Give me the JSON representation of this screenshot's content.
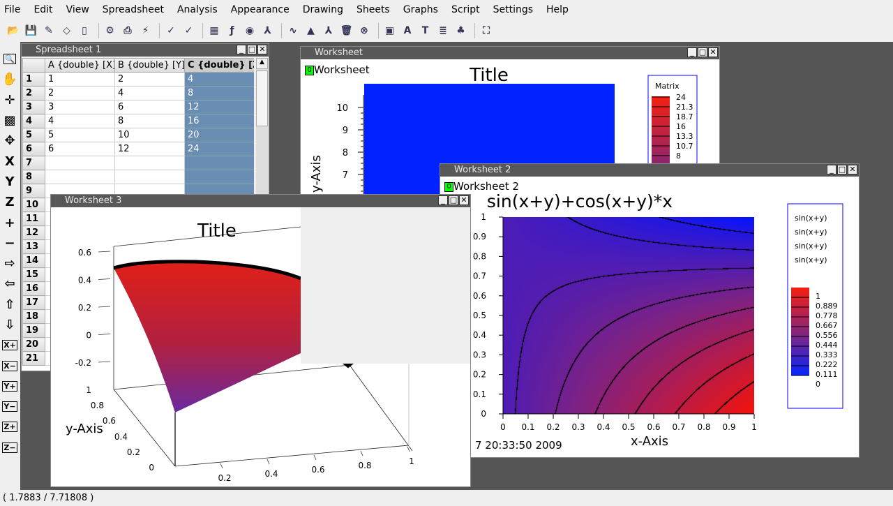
{
  "menu": [
    "File",
    "Edit",
    "View",
    "Spreadsheet",
    "Analysis",
    "Appearance",
    "Drawing",
    "Sheets",
    "Graphs",
    "Script",
    "Settings",
    "Help"
  ],
  "toolbar": [
    {
      "icon": "open-folder-icon",
      "glyph": "📂"
    },
    {
      "icon": "save-icon",
      "glyph": "💾"
    },
    {
      "icon": "edit-icon",
      "glyph": "✎"
    },
    {
      "icon": "eraser-icon",
      "glyph": "◇"
    },
    {
      "icon": "clipboard-icon",
      "glyph": "▯"
    },
    {
      "sep": true
    },
    {
      "icon": "print-preview-icon",
      "glyph": "⚙"
    },
    {
      "icon": "print-icon",
      "glyph": "⎙"
    },
    {
      "icon": "export-icon",
      "glyph": "⚡"
    },
    {
      "sep": true
    },
    {
      "icon": "chart-check-icon",
      "glyph": "✓"
    },
    {
      "icon": "chart-check-red-icon",
      "glyph": "✓"
    },
    {
      "sep": true
    },
    {
      "icon": "table-values-icon",
      "glyph": "▦"
    },
    {
      "icon": "function-icon",
      "glyph": "ƒ"
    },
    {
      "icon": "contour-icon",
      "glyph": "◉"
    },
    {
      "icon": "surface-icon",
      "glyph": "⅄"
    },
    {
      "sep": true
    },
    {
      "icon": "plot-icon",
      "glyph": "∿"
    },
    {
      "icon": "plot3d-icon",
      "glyph": "▲"
    },
    {
      "icon": "surface2-icon",
      "glyph": "⅄"
    },
    {
      "icon": "trash-icon",
      "glyph": "🗑"
    },
    {
      "icon": "close-circle-icon",
      "glyph": "⊗"
    },
    {
      "sep": true
    },
    {
      "icon": "image-icon",
      "glyph": "▣"
    },
    {
      "icon": "text-bold-icon",
      "glyph": "A"
    },
    {
      "icon": "text-icon",
      "glyph": "T"
    },
    {
      "icon": "note-icon",
      "glyph": "≣"
    },
    {
      "icon": "tree-icon",
      "glyph": "♣"
    },
    {
      "sep": true
    },
    {
      "icon": "fullscreen-icon",
      "glyph": "⛶"
    }
  ],
  "left_tools": [
    {
      "icon": "zoom-icon",
      "glyph": "🔍"
    },
    {
      "icon": "hand-icon",
      "glyph": "✋"
    },
    {
      "icon": "crosshair-icon",
      "glyph": "✛"
    },
    {
      "icon": "picture-icon",
      "glyph": "▩"
    },
    {
      "icon": "move-icon",
      "glyph": "✥"
    },
    {
      "icon": "x-rotate-icon",
      "glyph": "X"
    },
    {
      "icon": "y-rotate-icon",
      "glyph": "Y"
    },
    {
      "icon": "z-rotate-icon",
      "glyph": "Z"
    },
    {
      "icon": "plus-icon",
      "glyph": "+"
    },
    {
      "icon": "minus-icon",
      "glyph": "−"
    },
    {
      "icon": "arrow-right-icon",
      "glyph": "⇨"
    },
    {
      "icon": "arrow-left-icon",
      "glyph": "⇦"
    },
    {
      "icon": "arrow-up-icon",
      "glyph": "⇧"
    },
    {
      "icon": "arrow-down-icon",
      "glyph": "⇩"
    },
    {
      "icon": "x-plus-icon",
      "glyph": "X+"
    },
    {
      "icon": "x-minus-icon",
      "glyph": "X−"
    },
    {
      "icon": "y-plus-icon",
      "glyph": "Y+"
    },
    {
      "icon": "y-minus-icon",
      "glyph": "Y−"
    },
    {
      "icon": "z-plus-icon",
      "glyph": "Z+"
    },
    {
      "icon": "z-minus-icon",
      "glyph": "Z−"
    }
  ],
  "spreadsheet": {
    "title": "Spreadsheet 1",
    "columns": [
      "A {double} [X]",
      "B {double} [Y]",
      "C {double} [Z]"
    ],
    "rows": [
      [
        "1",
        "2",
        "4"
      ],
      [
        "2",
        "4",
        "8"
      ],
      [
        "3",
        "6",
        "12"
      ],
      [
        "4",
        "8",
        "16"
      ],
      [
        "5",
        "10",
        "20"
      ],
      [
        "6",
        "12",
        "24"
      ]
    ],
    "row_count": 21,
    "selected_column": "C",
    "selection_color": "#6a8db3"
  },
  "worksheet1": {
    "title": "Worksheet",
    "label": "Worksheet",
    "label_index": "0",
    "plot_title": "Title",
    "y_axis_label": "y-Axis",
    "y_ticks": [
      "10",
      "9",
      "8",
      "7"
    ],
    "fill_color": "#0022ff",
    "legend": {
      "title": "Matrix",
      "values": [
        "24",
        "21.3",
        "18.7",
        "16",
        "13.3",
        "10.7",
        "8"
      ]
    }
  },
  "worksheet2": {
    "title": "Worksheet 2",
    "label": "Worksheet 2",
    "label_index": "0",
    "plot_title": "sin(x+y)+cos(x+y)*x",
    "x_axis_label": "x-Axis",
    "x_ticks": [
      "0",
      "0.1",
      "0.2",
      "0.3",
      "0.4",
      "0.5",
      "0.6",
      "0.7",
      "0.8",
      "0.9",
      "1"
    ],
    "y_ticks": [
      "0",
      "0.1",
      "0.2",
      "0.3",
      "0.4",
      "0.5",
      "0.6",
      "0.7",
      "0.8",
      "0.9",
      "1"
    ],
    "timestamp": "7 20:33:50 2009",
    "legend": {
      "entries": [
        "sin(x+y)",
        "sin(x+y)",
        "sin(x+y)",
        "sin(x+y)"
      ],
      "values": [
        "1",
        "0.889",
        "0.778",
        "0.667",
        "0.556",
        "0.444",
        "0.333",
        "0.222",
        "0.111",
        "0"
      ]
    },
    "colors": {
      "low": "#0022ff",
      "high": "#ff2200"
    }
  },
  "worksheet3": {
    "title": "Worksheet 3",
    "plot_title": "Title",
    "y_axis_label": "y-Axis",
    "z_ticks": [
      "0.6",
      "0.4",
      "0.2",
      "0",
      "-0.2"
    ],
    "y_ticks": [
      "1",
      "0.8",
      "0.6",
      "0.4",
      "0.2",
      "0"
    ],
    "x_ticks": [
      "0.2",
      "0.4",
      "0.6",
      "0.8",
      "1"
    ]
  },
  "status": "( 1.7883 / 7.71808 )"
}
